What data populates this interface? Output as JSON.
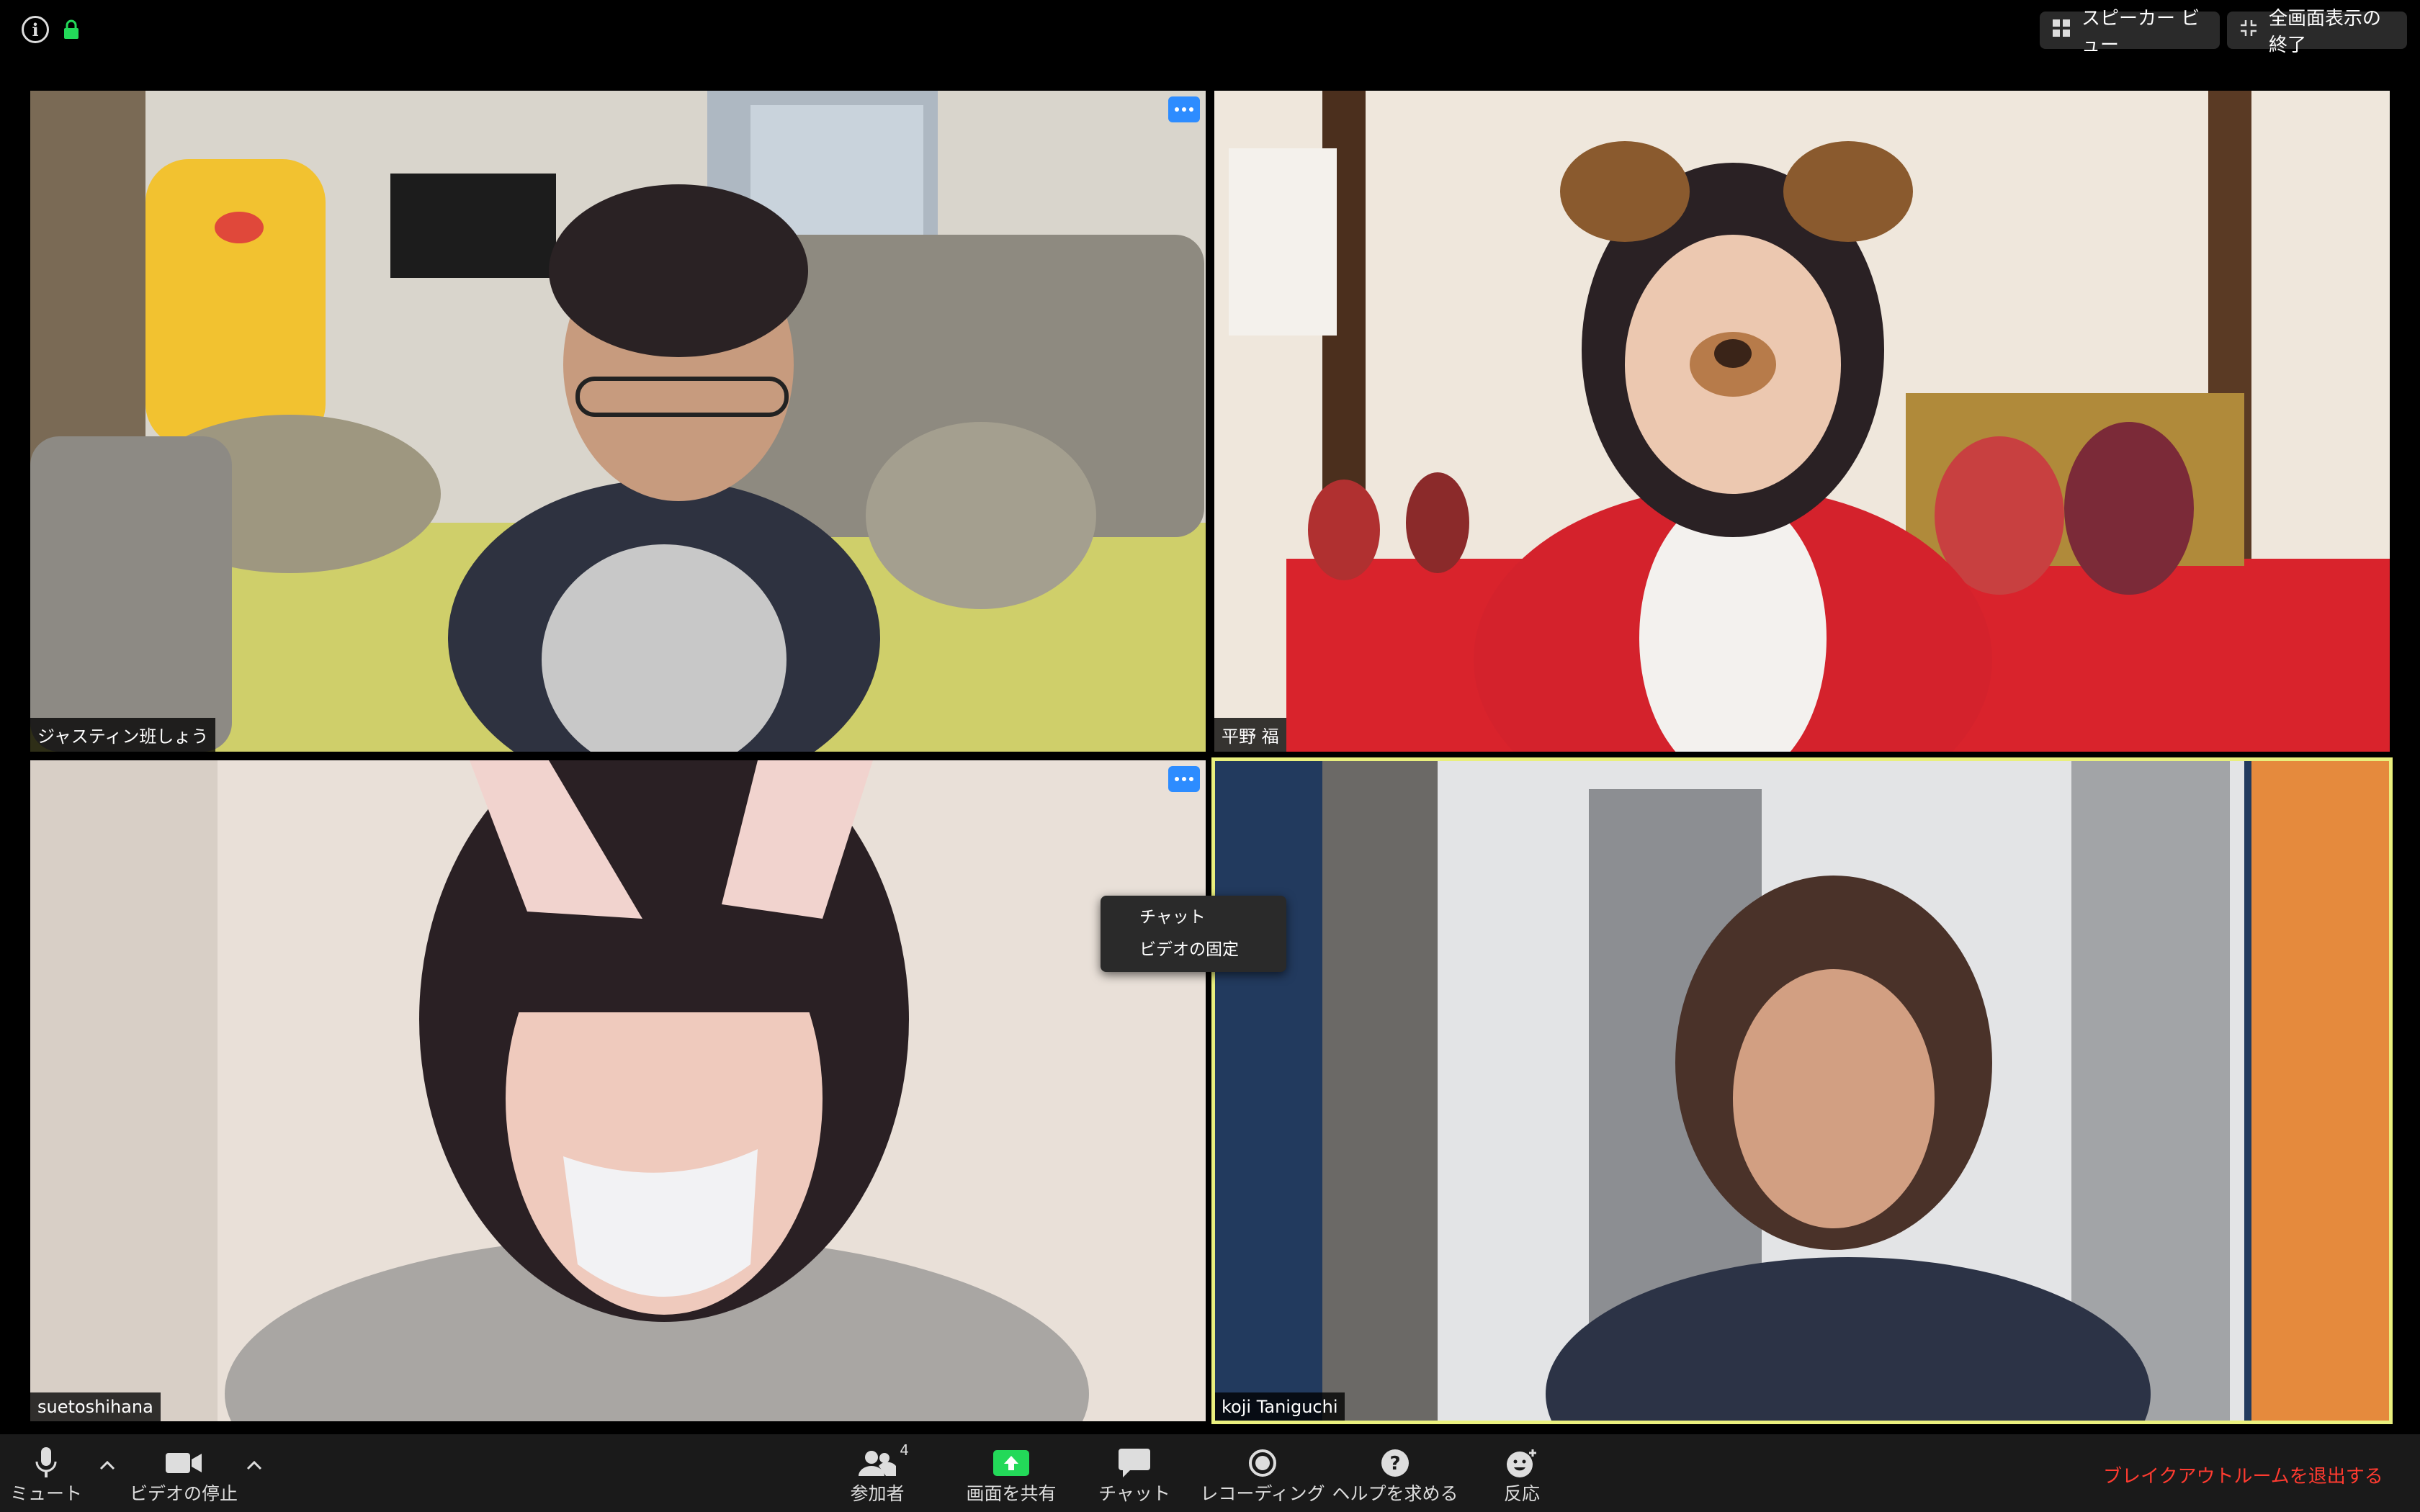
{
  "window": {
    "view_button_label": "スピーカー ビュー",
    "exit_fullscreen_label": "全画面表示の終了"
  },
  "participants": [
    {
      "name": "ジャスティン班しょう"
    },
    {
      "name": "平野 福"
    },
    {
      "name": "suetoshihana"
    },
    {
      "name": "koji Taniguchi"
    }
  ],
  "context_menu": {
    "items": [
      "チャット",
      "ビデオの固定"
    ]
  },
  "toolbar": {
    "mute": "ミュート",
    "stop_video": "ビデオの停止",
    "participants": "参加者",
    "participants_count": "4",
    "share": "画面を共有",
    "chat": "チャット",
    "record": "レコーディング",
    "help": "ヘルプを求める",
    "reactions": "反応",
    "leave_breakout": "ブレイクアウトルームを退出する"
  },
  "colors": {
    "active_speaker_border": "#e9ef7d",
    "share_green": "#23d959",
    "more_button_blue": "#2d8cff",
    "leave_red": "#ff3b30"
  },
  "icons": [
    "info-icon",
    "lock-icon",
    "grid-icon",
    "exit-fullscreen-icon",
    "more-icon",
    "microphone-icon",
    "video-camera-icon",
    "chevron-up-icon",
    "participants-icon",
    "share-screen-icon",
    "chat-icon",
    "record-icon",
    "help-icon",
    "reaction-icon"
  ]
}
